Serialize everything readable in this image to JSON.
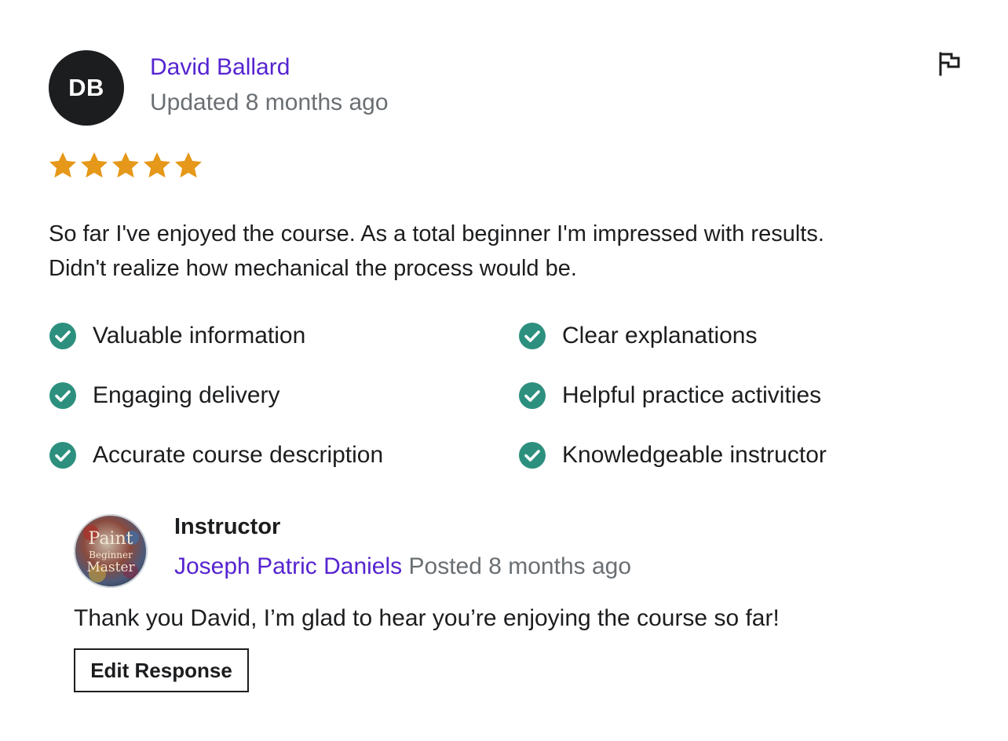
{
  "reviewer": {
    "initials": "DB",
    "name": "David Ballard",
    "meta": "Updated 8 months ago",
    "avatar_bg": "#1c1d1f"
  },
  "rating": {
    "value": 5,
    "max": 5,
    "star_color": "#e59819"
  },
  "flag_icon": "flag-icon",
  "review_text_line1": "So far I've enjoyed the course. As a total beginner I'm impressed with results.",
  "review_text_line2": "Didn't realize how mechanical the process would be.",
  "tags": [
    {
      "label": "Valuable information"
    },
    {
      "label": "Clear explanations"
    },
    {
      "label": "Engaging delivery"
    },
    {
      "label": "Helpful practice activities"
    },
    {
      "label": "Accurate course description"
    },
    {
      "label": "Knowledgeable instructor"
    }
  ],
  "check_color": "#2d907f",
  "instructor": {
    "role": "Instructor",
    "name": "Joseph Patric Daniels",
    "meta": "Posted 8 months ago",
    "response": "Thank you David, I’m glad to hear you’re enjoying the course so far!",
    "edit_label": "Edit Response",
    "avatar_text_line1": "Paint",
    "avatar_text_line2": "Beginner",
    "avatar_text_line3": "Master"
  },
  "colors": {
    "link": "#5624d0",
    "muted": "#6a6f73",
    "text": "#1c1d1f"
  }
}
